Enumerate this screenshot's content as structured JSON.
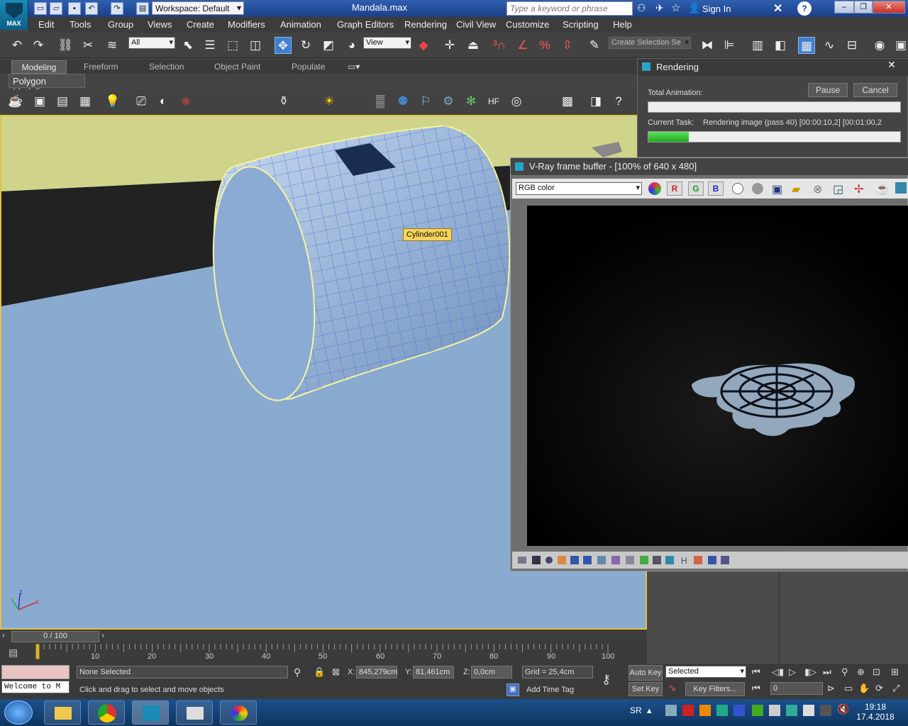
{
  "titlebar": {
    "workspace": "Workspace: Default",
    "file_title": "Mandala.max",
    "search_placeholder": "Type a keyword or phrase",
    "sign_in": "Sign In",
    "app_logo_text": "MAX"
  },
  "menu": [
    "Edit",
    "Tools",
    "Group",
    "Views",
    "Create",
    "Modifiers",
    "Animation",
    "Graph Editors",
    "Rendering",
    "Civil View",
    "Customize",
    "Scripting",
    "Help"
  ],
  "main_toolbar": {
    "filter_select": "All",
    "view_select": "View",
    "selection_set_placeholder": "Create Selection Se"
  },
  "ribbon": {
    "tabs": [
      "Modeling",
      "Freeform",
      "Selection",
      "Object Paint",
      "Populate"
    ],
    "panel_label": "Polygon Modeling"
  },
  "viewport": {
    "object_label": "Cylinder001",
    "axis_x": "x",
    "axis_z": "z"
  },
  "timeline": {
    "frame_counter": "0 / 100",
    "ticks": [
      "10",
      "20",
      "30",
      "40",
      "50",
      "60",
      "70",
      "80",
      "90",
      "100"
    ]
  },
  "status": {
    "listener_text": "Welcome to M",
    "selection": "None Selected",
    "prompt": "Click and drag to select and move objects",
    "x_label": "X:",
    "x_value": "845,279cm",
    "y_label": "Y:",
    "y_value": "81,461cm",
    "z_label": "Z:",
    "z_value": "0,0cm",
    "grid": "Grid = 25,4cm",
    "add_time_tag": "Add Time Tag",
    "auto_key": "Auto Key",
    "set_key": "Set Key",
    "key_mode": "Selected",
    "key_filters": "Key Filters...",
    "current_frame": "0"
  },
  "rendering_dialog": {
    "title": "Rendering",
    "total_animation_label": "Total Animation:",
    "pause": "Pause",
    "cancel": "Cancel",
    "current_task_label": "Current Task:",
    "current_task": "Rendering image (pass 40) [00:00:10,2] [00:01:00,2",
    "total_progress": 0.0,
    "task_progress": 0.16
  },
  "vfb": {
    "title": "V-Ray frame buffer - [100% of 640 x 480]",
    "channel": "RGB color",
    "r": "R",
    "g": "G",
    "b": "B"
  },
  "taskbar": {
    "lang": "SR",
    "time": "19:18",
    "date": "17.4.2018"
  },
  "colors": {
    "accent_blue": "#1d3f86",
    "selection_yellow": "#f6d35c",
    "progress_green": "#21a821"
  }
}
